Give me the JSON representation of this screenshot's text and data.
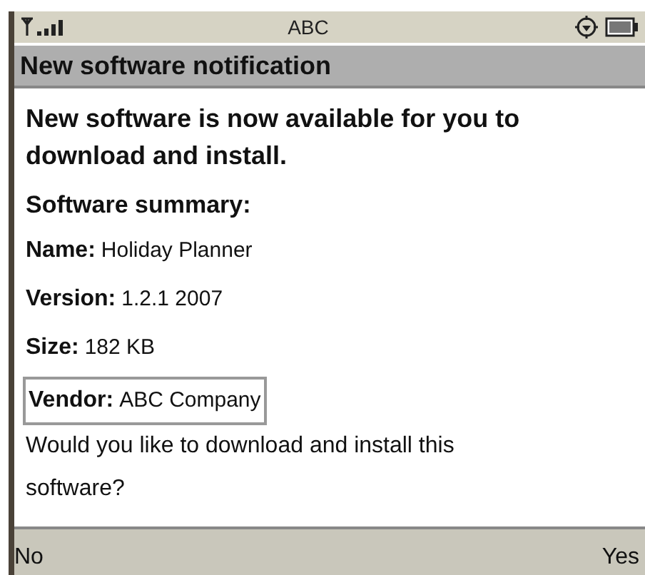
{
  "status_bar": {
    "operator": "ABC"
  },
  "title": "New software notification",
  "message": "New software is now available for you to download and install.",
  "summary_heading": "Software summary:",
  "fields": [
    {
      "label": "Name:",
      "value": "Holiday Planner",
      "selected": false
    },
    {
      "label": "Version:",
      "value": "1.2.1 2007",
      "selected": false
    },
    {
      "label": "Size:",
      "value": "182 KB",
      "selected": false
    },
    {
      "label": "Vendor:",
      "value": "ABC Company",
      "selected": true
    }
  ],
  "question": "Would you like to download and install this software?",
  "softkeys": {
    "left": "No",
    "right": "Yes"
  }
}
